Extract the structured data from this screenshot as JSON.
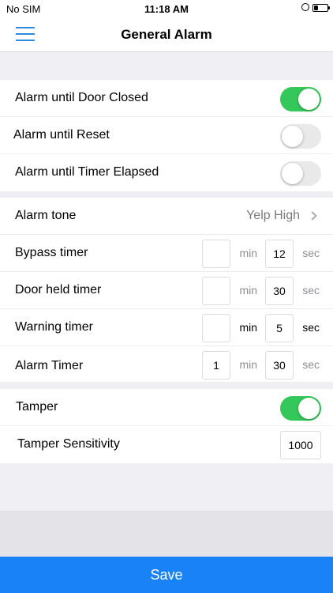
{
  "status": {
    "carrier": "No SIM",
    "time": "11:18 AM",
    "battery_level": 0.3
  },
  "nav": {
    "title": "General Alarm",
    "menu_icon": "hamburger-icon"
  },
  "alarm_section": [
    {
      "label": "Alarm until Door Closed",
      "on": true
    },
    {
      "label": "Alarm until Reset",
      "on": false
    },
    {
      "label": "Alarm until Timer Elapsed",
      "on": false
    }
  ],
  "tone": {
    "label": "Alarm tone",
    "value": "Yelp High"
  },
  "timers": [
    {
      "label": "Bypass timer",
      "min": "",
      "sec": "12",
      "min_unit": "min",
      "sec_unit": "sec",
      "units_dark": false
    },
    {
      "label": "Door held timer",
      "min": "",
      "sec": "30",
      "min_unit": "min",
      "sec_unit": "sec",
      "units_dark": false
    },
    {
      "label": "Warning timer",
      "min": "",
      "sec": "5",
      "min_unit": "min",
      "sec_unit": "sec",
      "units_dark": true
    },
    {
      "label": "Alarm Timer",
      "min": "1",
      "sec": "30",
      "min_unit": "min",
      "sec_unit": "sec",
      "units_dark": false
    }
  ],
  "tamper": {
    "label": "Tamper",
    "on": true
  },
  "sensitivity": {
    "label": "Tamper Sensitivity",
    "value": "1000"
  },
  "save_label": "Save",
  "colors": {
    "toggle_on": "#34c759",
    "save_bg": "#1a82f7",
    "menu": "#2a8ae0"
  }
}
